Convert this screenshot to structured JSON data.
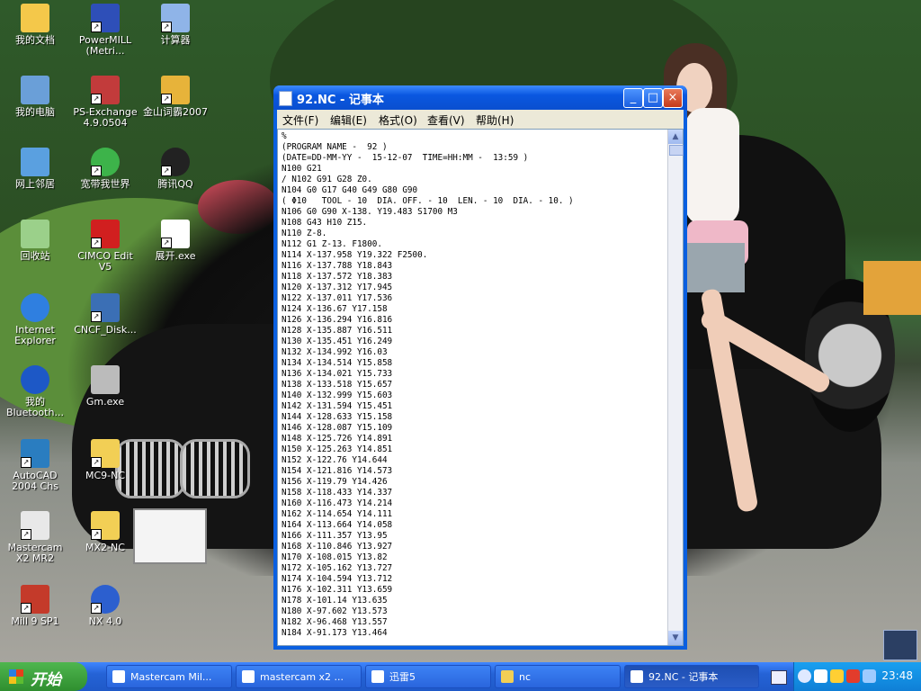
{
  "desktop": {
    "icons": [
      {
        "label": "我的文档",
        "icon": "my-documents-icon",
        "color": "#f4c84a"
      },
      {
        "label": "PowerMILL (Metri...",
        "icon": "powermill-icon",
        "color": "#2e4fb8"
      },
      {
        "label": "计算器",
        "icon": "calculator-icon",
        "color": "#8fb4e8"
      },
      {
        "label": "我的电脑",
        "icon": "my-computer-icon",
        "color": "#6a9fd8"
      },
      {
        "label": "PS-Exchange 4.9.0504",
        "icon": "ps-exchange-icon",
        "color": "#c23b3b"
      },
      {
        "label": "金山词霸2007",
        "icon": "kingsoft-dictionary-icon",
        "color": "#e7b33a"
      },
      {
        "label": "网上邻居",
        "icon": "network-places-icon",
        "color": "#5aa0e0"
      },
      {
        "label": "宽带我世界",
        "icon": "broadband-icon",
        "color": "#3db34a"
      },
      {
        "label": "腾讯QQ",
        "icon": "qq-icon",
        "color": "#222222"
      },
      {
        "label": "回收站",
        "icon": "recycle-bin-icon",
        "color": "#9bd08a"
      },
      {
        "label": "CIMCO Edit V5",
        "icon": "cimco-edit-icon",
        "color": "#d11f1f"
      },
      {
        "label": "展开.exe",
        "icon": "executable-icon",
        "color": "#ffffff"
      },
      {
        "label": "Internet Explorer",
        "icon": "internet-explorer-icon",
        "color": "#2f7fe0"
      },
      {
        "label": "CNCF_Disk...",
        "icon": "cncf-disk-icon",
        "color": "#3b6fb5"
      },
      {
        "label": "我的 Bluetooth...",
        "icon": "bluetooth-icon",
        "color": "#1d58c6"
      },
      {
        "label": "Gm.exe",
        "icon": "gm-exe-icon",
        "color": "#bbbbbb"
      },
      {
        "label": "AutoCAD 2004 Chs",
        "icon": "autocad-icon",
        "color": "#2a7dc0"
      },
      {
        "label": "MC9-NC",
        "icon": "folder-icon",
        "color": "#f2cf55"
      },
      {
        "label": "Mastercam X2 MR2",
        "icon": "mastercam-icon",
        "color": "#e8e8e8"
      },
      {
        "label": "MX2-NC",
        "icon": "folder-icon",
        "color": "#f2cf55"
      },
      {
        "label": "Mill 9 SP1",
        "icon": "mill-icon",
        "color": "#c43a2a"
      },
      {
        "label": "NX 4.0",
        "icon": "nx-icon",
        "color": "#2c5fcf"
      }
    ]
  },
  "window": {
    "title": "92.NC - 记事本",
    "menus": [
      "文件(F)",
      "编辑(E)",
      "格式(O)",
      "查看(V)",
      "帮助(H)"
    ],
    "minimize": "_",
    "maximize": "□",
    "close": "×",
    "content": "%\n(PROGRAM NAME -  92 )\n(DATE=DD-MM-YY -  15-12-07  TIME=HH:MM -  13:59 )\nN100 G21\n/ N102 G91 G28 Z0.\nN104 G0 G17 G40 G49 G80 G90\n( Φ10   TOOL - 10  DIA. OFF. - 10  LEN. - 10  DIA. - 10. )\nN106 G0 G90 X-138. Y19.483 S1700 M3\nN108 G43 H10 Z15.\nN110 Z-8.\nN112 G1 Z-13. F1800.\nN114 X-137.958 Y19.322 F2500.\nN116 X-137.788 Y18.843\nN118 X-137.572 Y18.383\nN120 X-137.312 Y17.945\nN122 X-137.011 Y17.536\nN124 X-136.67 Y17.158\nN126 X-136.294 Y16.816\nN128 X-135.887 Y16.511\nN130 X-135.451 Y16.249\nN132 X-134.992 Y16.03\nN134 X-134.514 Y15.858\nN136 X-134.021 Y15.733\nN138 X-133.518 Y15.657\nN140 X-132.999 Y15.603\nN142 X-131.594 Y15.451\nN144 X-128.633 Y15.158\nN146 X-128.087 Y15.109\nN148 X-125.726 Y14.891\nN150 X-125.263 Y14.851\nN152 X-122.76 Y14.644\nN154 X-121.816 Y14.573\nN156 X-119.79 Y14.426\nN158 X-118.433 Y14.337\nN160 X-116.473 Y14.214\nN162 X-114.654 Y14.111\nN164 X-113.664 Y14.058\nN166 X-111.357 Y13.95\nN168 X-110.846 Y13.927\nN170 X-108.015 Y13.82\nN172 X-105.162 Y13.727\nN174 X-104.594 Y13.712\nN176 X-102.311 Y13.659\nN178 X-101.14 Y13.635\nN180 X-97.602 Y13.573\nN182 X-96.468 Y13.557\nN184 X-91.173 Y13.464"
  },
  "taskbar": {
    "start_label": "开始",
    "tasks": [
      {
        "label": "Mastercam Mil...",
        "icon": "mastercam-icon"
      },
      {
        "label": "mastercam x2 ...",
        "icon": "document-icon"
      },
      {
        "label": "迅雷5",
        "icon": "thunder-icon"
      },
      {
        "label": "nc",
        "icon": "folder-icon"
      },
      {
        "label": "92.NC - 记事本",
        "icon": "notepad-icon"
      }
    ],
    "clock": "23:48"
  },
  "colors": {
    "taskbar_blue": "#2563d6",
    "start_green": "#3a9d3a",
    "titlebar_blue": "#0a57e0",
    "menubar_gray": "#ece9d8",
    "tray_blue": "#0f7fd6"
  }
}
